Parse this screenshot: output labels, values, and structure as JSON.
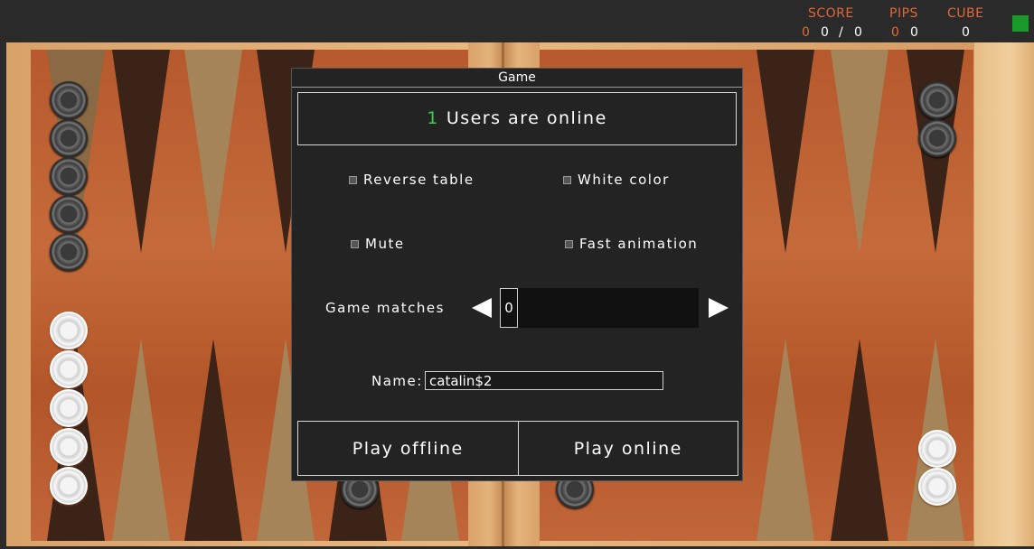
{
  "header": {
    "score_label": "SCORE",
    "pips_label": "PIPS",
    "cube_label": "CUBE",
    "score_values": [
      "0",
      "0",
      "/",
      "0"
    ],
    "pips_values": [
      "0",
      "0"
    ],
    "cube_value": "0"
  },
  "dialog": {
    "title": "Game",
    "online_count": "1",
    "online_text": "Users are online",
    "options": {
      "reverse_table": "Reverse table",
      "white_color": "White color",
      "mute": "Mute",
      "fast_animation": "Fast animation"
    },
    "game_matches_label": "Game matches",
    "game_matches_value": "0",
    "name_label": "Name:",
    "name_value": "catalin$2",
    "play_offline": "Play offline",
    "play_online": "Play online"
  },
  "colors": {
    "accent_orange": "#e0683a",
    "online_green": "#39d04a",
    "indicator_green": "#1a9a2a"
  }
}
